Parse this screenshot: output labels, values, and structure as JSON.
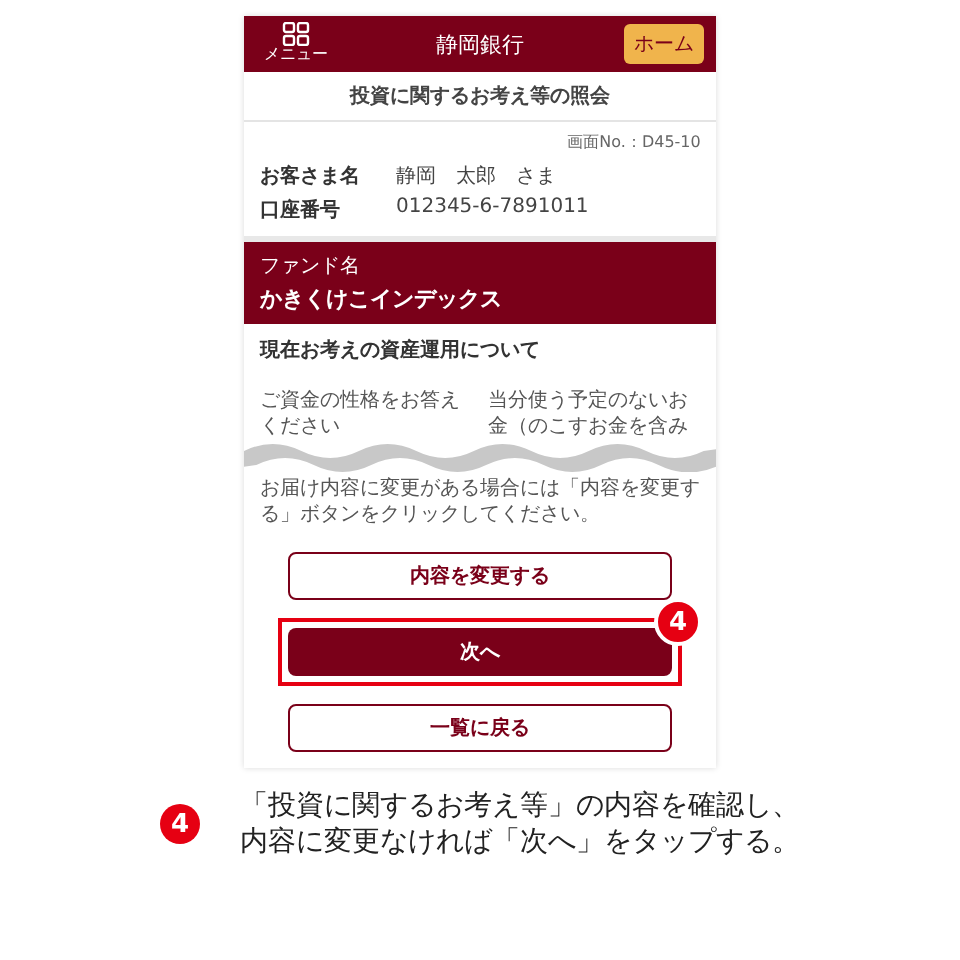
{
  "header": {
    "menu_label": "メニュー",
    "title": "静岡銀行",
    "home_button": "ホーム"
  },
  "page_title": "投資に関するお考え等の照会",
  "screen_no": "画面No.：D45-10",
  "customer": {
    "label": "お客さま名",
    "name": "静岡　太郎",
    "honorific": "さま"
  },
  "account": {
    "label": "口座番号",
    "value": "012345-6-7891011"
  },
  "fund": {
    "label": "ファンド名",
    "name": "かきくけこインデックス"
  },
  "section": {
    "title": "現在お考えの資産運用について",
    "question": "ご資金の性格をお答えください",
    "answer": "当分使う予定のないお金（のこすお金を含み"
  },
  "note": "お届け内容に変更がある場合には「内容を変更する」ボタンをクリックしてください。",
  "buttons": [
    {
      "label": "内容を変更する",
      "kind": "outline",
      "highlighted": false
    },
    {
      "label": "次へ",
      "kind": "primary",
      "highlighted": true,
      "callout": "4"
    },
    {
      "label": "一覧に戻る",
      "kind": "outline",
      "highlighted": false
    }
  ],
  "instruction": {
    "number": "4",
    "lines": [
      "「投資に関するお考え等」の内容を確認し、",
      "内容に変更なければ「次へ」をタップする。"
    ]
  }
}
